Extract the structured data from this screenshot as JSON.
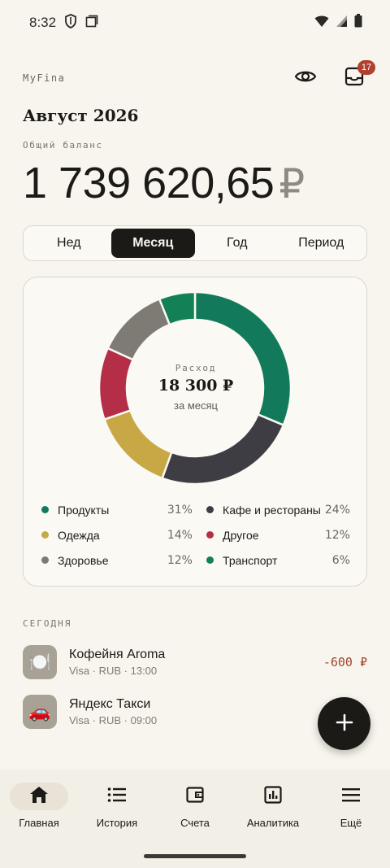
{
  "status_bar": {
    "time": "8:32"
  },
  "header": {
    "brand": "MyFina",
    "notifications_count": "17"
  },
  "month_title": "Август 2026",
  "balance": {
    "label": "Общий баланс",
    "amount": "1 739 620,65",
    "currency": "₽"
  },
  "period_tabs": [
    {
      "label": "Нед",
      "active": false
    },
    {
      "label": "Месяц",
      "active": true
    },
    {
      "label": "Год",
      "active": false
    },
    {
      "label": "Период",
      "active": false
    }
  ],
  "chart_data": {
    "type": "pie",
    "center": {
      "label": "Расход",
      "value": "18 300 ₽",
      "sub": "за месяц"
    },
    "categories": [
      "Продукты",
      "Кафе и рестораны",
      "Одежда",
      "Другое",
      "Здоровье",
      "Транспорт"
    ],
    "values": [
      31,
      24,
      14,
      12,
      12,
      6
    ],
    "percent_labels": [
      "31%",
      "24%",
      "14%",
      "12%",
      "12%",
      "6%"
    ],
    "colors": [
      "#127a5a",
      "#3e3d44",
      "#c8a845",
      "#b52e48",
      "#7e7a74",
      "#138056"
    ],
    "legend_placement": "bottom"
  },
  "today": {
    "label": "Сегодня",
    "transactions": [
      {
        "name": "Кофейня Aroma",
        "meta": "Visa · RUB · 13:00",
        "amount": "-600 ₽",
        "icon": "🍽️"
      },
      {
        "name": "Яндекс Такси",
        "meta": "Visa · RUB · 09:00",
        "amount": "",
        "icon": "🚗"
      }
    ]
  },
  "bottom_nav": [
    {
      "label": "Главная",
      "icon": "home-icon",
      "active": true
    },
    {
      "label": "История",
      "icon": "list-icon",
      "active": false
    },
    {
      "label": "Счета",
      "icon": "wallet-icon",
      "active": false
    },
    {
      "label": "Аналитика",
      "icon": "analytics-icon",
      "active": false
    },
    {
      "label": "Ещё",
      "icon": "menu-icon",
      "active": false
    }
  ]
}
